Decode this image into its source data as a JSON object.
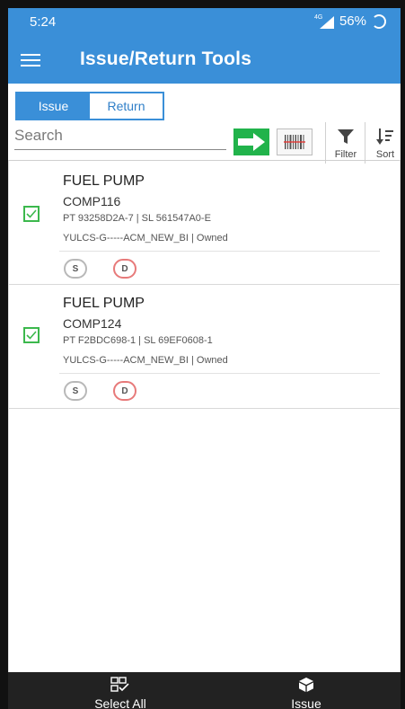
{
  "status_bar": {
    "time": "5:24",
    "network": "4G",
    "battery": "56%"
  },
  "app_bar": {
    "title": "Issue/Return Tools"
  },
  "tabs": [
    {
      "label": "Issue",
      "active": true
    },
    {
      "label": "Return",
      "active": false
    }
  ],
  "search": {
    "placeholder": "Search",
    "value": ""
  },
  "toolbar": {
    "filter_label": "Filter",
    "sort_label": "Sort"
  },
  "items": [
    {
      "name": "FUEL PUMP",
      "code": "COMP116",
      "pt_sl": "PT 93258D2A-7 | SL 561547A0-E",
      "location": "YULCS-G-----ACM_NEW_BI | Owned",
      "checked": true,
      "badge_s": "S",
      "badge_d": "D"
    },
    {
      "name": "FUEL PUMP",
      "code": "COMP124",
      "pt_sl": "PT F2BDC698-1 | SL 69EF0608-1",
      "location": "YULCS-G-----ACM_NEW_BI | Owned",
      "checked": true,
      "badge_s": "S",
      "badge_d": "D"
    }
  ],
  "bottom_bar": {
    "select_all_label": "Select All",
    "issue_label": "Issue"
  },
  "colors": {
    "primary": "#3a8fd8",
    "go_green": "#21b34b",
    "check_green": "#3cb84d",
    "badge_red": "#e77a7a",
    "bottom_bar": "#222222"
  }
}
